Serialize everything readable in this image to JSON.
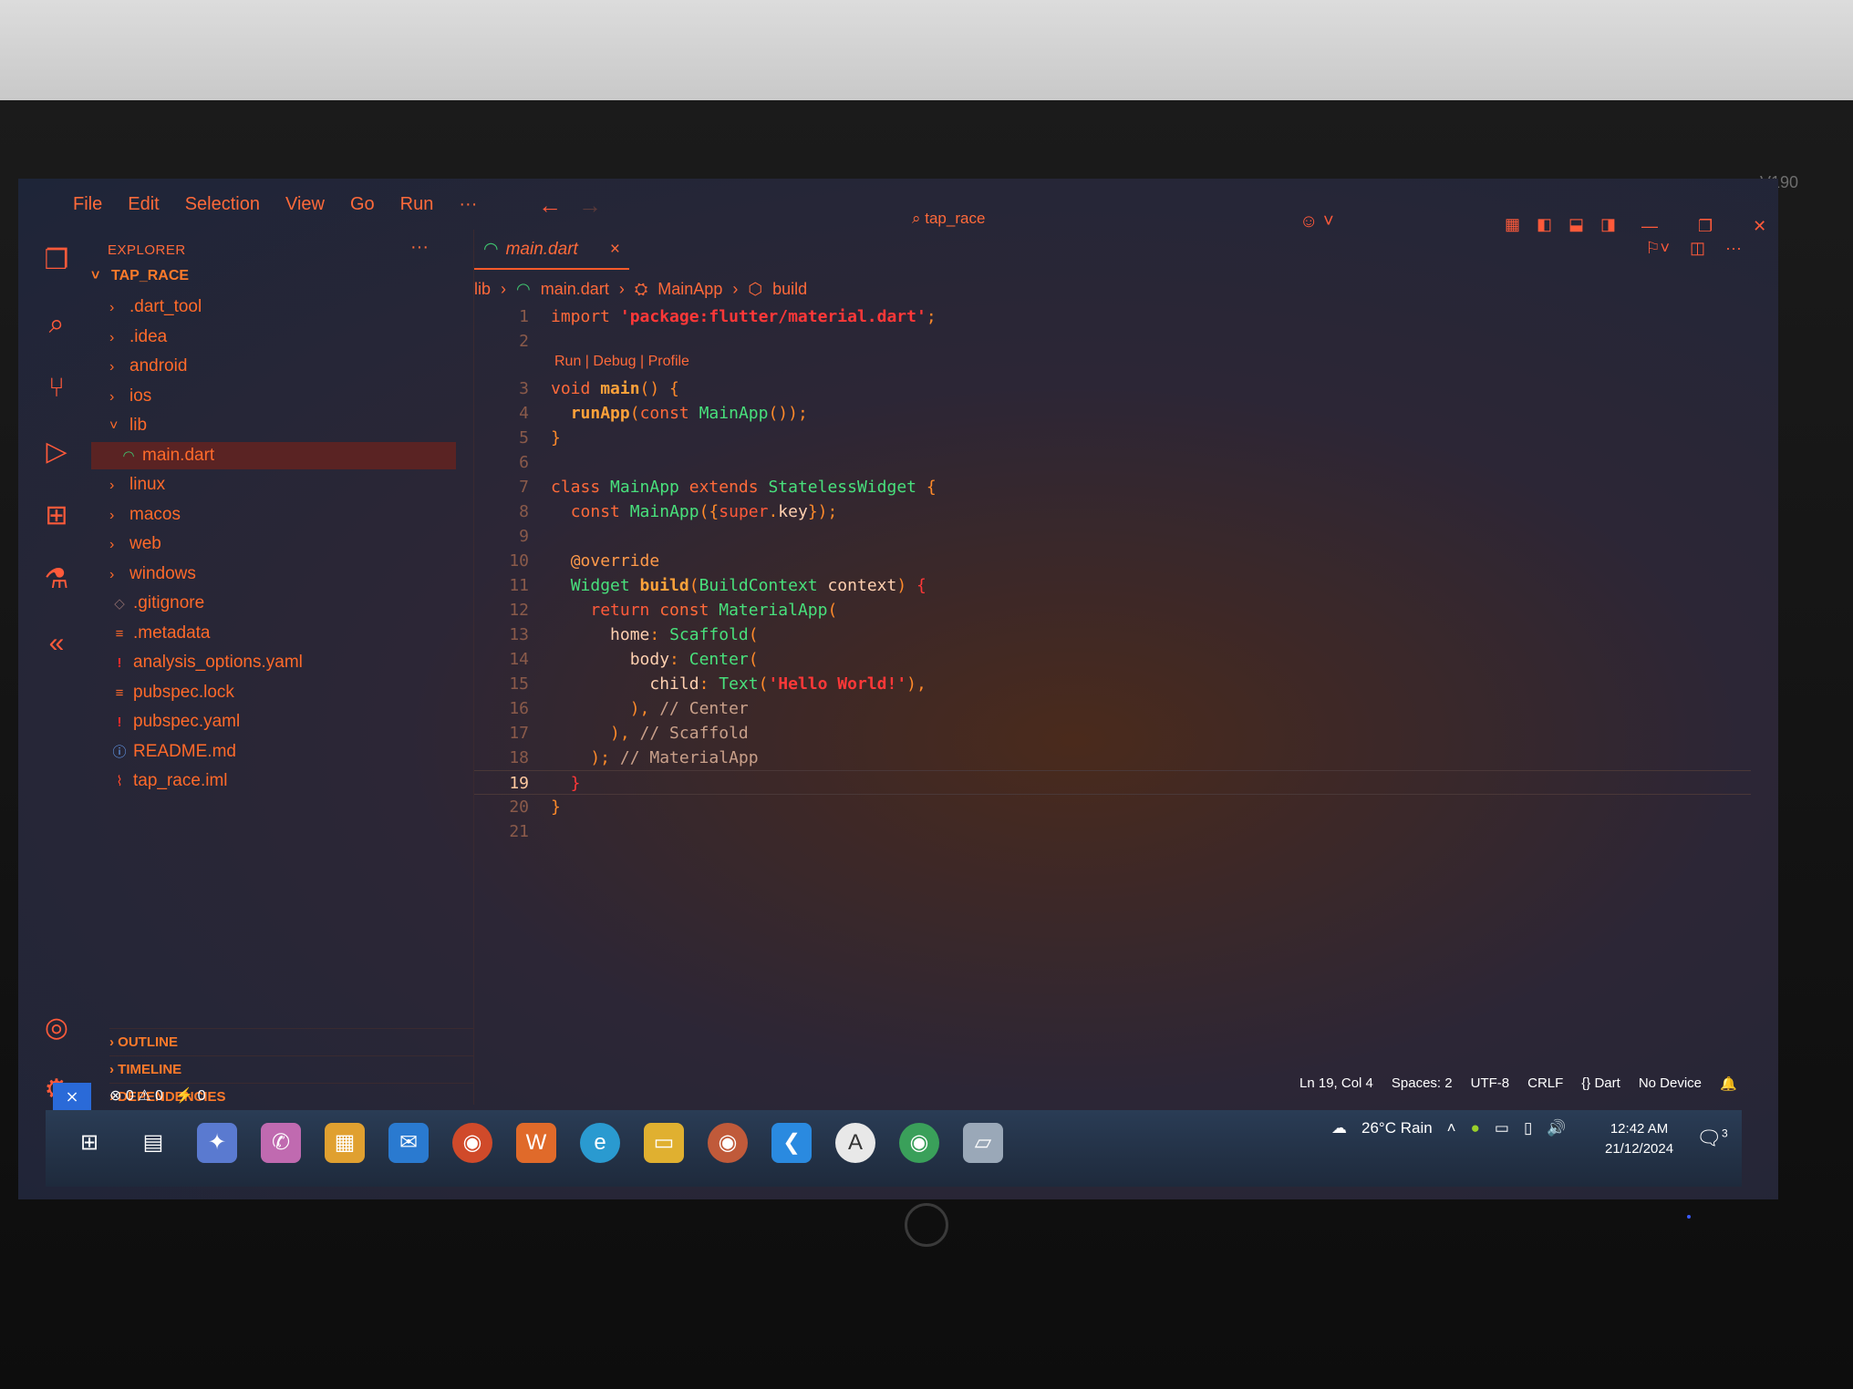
{
  "monitor": {
    "model": "V190"
  },
  "titlebar": {
    "menu": [
      "File",
      "Edit",
      "Selection",
      "View",
      "Go",
      "Run",
      "···"
    ],
    "search": "tap_race",
    "back_icon": "arrow-left-icon",
    "forward_icon": "arrow-right-icon"
  },
  "sidebar": {
    "header": "EXPLORER",
    "more": "···",
    "project": "TAP_RACE",
    "items": [
      {
        "label": ".dart_tool",
        "kind": "folder",
        "open": false,
        "depth": 1
      },
      {
        "label": ".idea",
        "kind": "folder",
        "open": false,
        "depth": 1
      },
      {
        "label": "android",
        "kind": "folder",
        "open": false,
        "depth": 1
      },
      {
        "label": "ios",
        "kind": "folder",
        "open": false,
        "depth": 1
      },
      {
        "label": "lib",
        "kind": "folder",
        "open": true,
        "depth": 1
      },
      {
        "label": "main.dart",
        "kind": "dart",
        "depth": 2,
        "active": true
      },
      {
        "label": "linux",
        "kind": "folder",
        "open": false,
        "depth": 1
      },
      {
        "label": "macos",
        "kind": "folder",
        "open": false,
        "depth": 1
      },
      {
        "label": "web",
        "kind": "folder",
        "open": false,
        "depth": 1
      },
      {
        "label": "windows",
        "kind": "folder",
        "open": false,
        "depth": 1
      },
      {
        "label": ".gitignore",
        "kind": "git",
        "depth": 1
      },
      {
        "label": ".metadata",
        "kind": "lines",
        "depth": 1
      },
      {
        "label": "analysis_options.yaml",
        "kind": "warn",
        "depth": 1
      },
      {
        "label": "pubspec.lock",
        "kind": "lines",
        "depth": 1
      },
      {
        "label": "pubspec.yaml",
        "kind": "warn",
        "depth": 1
      },
      {
        "label": "README.md",
        "kind": "info",
        "depth": 1
      },
      {
        "label": "tap_race.iml",
        "kind": "rss",
        "depth": 1
      }
    ],
    "sections": [
      "OUTLINE",
      "TIMELINE",
      "DEPENDENCIES"
    ]
  },
  "editor": {
    "tab": {
      "label": "main.dart",
      "close": "×"
    },
    "breadcrumb": [
      "lib",
      "main.dart",
      "MainApp",
      "build"
    ],
    "codelens": "Run | Debug | Profile",
    "current_line": 19,
    "lines": [
      {
        "n": "1",
        "tokens": [
          [
            "kw2",
            "import "
          ],
          [
            "str",
            "'package:flutter/material.dart'"
          ],
          [
            "pun",
            ";"
          ]
        ]
      },
      {
        "n": "2",
        "tokens": []
      },
      {
        "n": "3",
        "tokens": [
          [
            "kw2",
            "void "
          ],
          [
            "fn",
            "main"
          ],
          [
            "pun",
            "() {"
          ]
        ]
      },
      {
        "n": "4",
        "tokens": [
          [
            "id",
            "  "
          ],
          [
            "fn",
            "runApp"
          ],
          [
            "pun",
            "("
          ],
          [
            "kw2",
            "const "
          ],
          [
            "cls",
            "MainApp"
          ],
          [
            "pun",
            "());"
          ]
        ]
      },
      {
        "n": "5",
        "tokens": [
          [
            "pun",
            "}"
          ]
        ]
      },
      {
        "n": "6",
        "tokens": []
      },
      {
        "n": "7",
        "tokens": [
          [
            "kw2",
            "class "
          ],
          [
            "cls",
            "MainApp "
          ],
          [
            "kw2",
            "extends "
          ],
          [
            "cls",
            "StatelessWidget "
          ],
          [
            "pun",
            "{"
          ]
        ]
      },
      {
        "n": "8",
        "tokens": [
          [
            "id",
            "  "
          ],
          [
            "kw2",
            "const "
          ],
          [
            "cls",
            "MainApp"
          ],
          [
            "pun",
            "({"
          ],
          [
            "kw",
            "super"
          ],
          [
            "pun",
            "."
          ],
          [
            "id",
            "key"
          ],
          [
            "pun",
            "});"
          ]
        ]
      },
      {
        "n": "9",
        "tokens": []
      },
      {
        "n": "10",
        "tokens": [
          [
            "id",
            "  "
          ],
          [
            "ann",
            "@override"
          ]
        ]
      },
      {
        "n": "11",
        "tokens": [
          [
            "id",
            "  "
          ],
          [
            "cls",
            "Widget "
          ],
          [
            "fn",
            "build"
          ],
          [
            "pun",
            "("
          ],
          [
            "cls",
            "BuildContext "
          ],
          [
            "id",
            "context"
          ],
          [
            "pun",
            ") "
          ],
          [
            "br",
            "{"
          ]
        ]
      },
      {
        "n": "12",
        "tokens": [
          [
            "id",
            "    "
          ],
          [
            "kw",
            "return "
          ],
          [
            "kw2",
            "const "
          ],
          [
            "cls",
            "MaterialApp"
          ],
          [
            "pun",
            "("
          ]
        ]
      },
      {
        "n": "13",
        "tokens": [
          [
            "id",
            "      home"
          ],
          [
            "pun",
            ": "
          ],
          [
            "cls",
            "Scaffold"
          ],
          [
            "pun",
            "("
          ]
        ]
      },
      {
        "n": "14",
        "tokens": [
          [
            "id",
            "        body"
          ],
          [
            "pun",
            ": "
          ],
          [
            "cls",
            "Center"
          ],
          [
            "pun",
            "("
          ]
        ]
      },
      {
        "n": "15",
        "tokens": [
          [
            "id",
            "          child"
          ],
          [
            "pun",
            ": "
          ],
          [
            "cls",
            "Text"
          ],
          [
            "pun",
            "("
          ],
          [
            "str",
            "'Hello World!'"
          ],
          [
            "pun",
            "),"
          ]
        ]
      },
      {
        "n": "16",
        "tokens": [
          [
            "pun",
            "        ), "
          ],
          [
            "cm",
            "// Center"
          ]
        ]
      },
      {
        "n": "17",
        "tokens": [
          [
            "pun",
            "      ), "
          ],
          [
            "cm",
            "// Scaffold"
          ]
        ]
      },
      {
        "n": "18",
        "tokens": [
          [
            "pun",
            "    ); "
          ],
          [
            "cm",
            "// MaterialApp"
          ]
        ]
      },
      {
        "n": "19",
        "tokens": [
          [
            "br",
            "  }"
          ]
        ]
      },
      {
        "n": "20",
        "tokens": [
          [
            "pun",
            "}"
          ]
        ]
      },
      {
        "n": "21",
        "tokens": []
      }
    ]
  },
  "statusbar": {
    "remote": "⨯",
    "problems": "⊗ 0 ⚠ 0",
    "ports": "⚡ 0",
    "right": [
      "Ln 19, Col 4",
      "Spaces: 2",
      "UTF-8",
      "CRLF",
      "{} Dart",
      "No Device",
      "🔔"
    ]
  },
  "taskbar": {
    "weather": "26°C  Rain",
    "time": "12:42 AM",
    "date": "21/12/2024",
    "notifications": "3"
  }
}
